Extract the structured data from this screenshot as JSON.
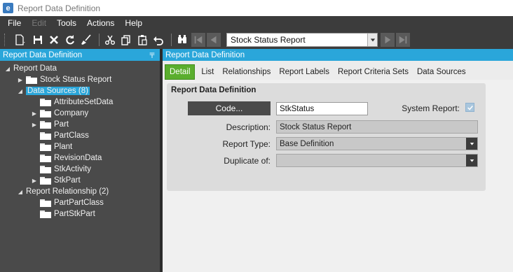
{
  "window": {
    "title": "Report Data Definition",
    "app_logo_letter": "e"
  },
  "menu": [
    "File",
    "Edit",
    "Tools",
    "Actions",
    "Help"
  ],
  "menu_disabled": [
    "Edit"
  ],
  "toolbar": {
    "icons": [
      "new-icon",
      "save-icon",
      "delete-icon",
      "refresh-icon",
      "clear-icon",
      "cut-icon",
      "copy-icon",
      "paste-icon",
      "undo-icon",
      "search-icon",
      "first-record-icon",
      "previous-record-icon",
      "next-record-icon",
      "last-record-icon"
    ],
    "record_selector": "Stock Status Report"
  },
  "left_panel": {
    "header": "Report Data Definition",
    "pin_glyph": "〒",
    "tree": [
      {
        "label": "Report Data",
        "expander": "◢",
        "level": 0,
        "folder": false
      },
      {
        "label": "Stock Status Report",
        "expander": "▶",
        "level": 1,
        "folder": true
      },
      {
        "label": "Data Sources (8)",
        "expander": "◢",
        "level": 1,
        "folder": false,
        "selected": true
      },
      {
        "label": "AttributeSetData",
        "expander": "",
        "level": 2,
        "folder": true
      },
      {
        "label": "Company",
        "expander": "▶",
        "level": 2,
        "folder": true
      },
      {
        "label": "Part",
        "expander": "▶",
        "level": 2,
        "folder": true
      },
      {
        "label": "PartClass",
        "expander": "",
        "level": 2,
        "folder": true
      },
      {
        "label": "Plant",
        "expander": "",
        "level": 2,
        "folder": true
      },
      {
        "label": "RevisionData",
        "expander": "",
        "level": 2,
        "folder": true
      },
      {
        "label": "StkActivity",
        "expander": "",
        "level": 2,
        "folder": true
      },
      {
        "label": "StkPart",
        "expander": "▶",
        "level": 2,
        "folder": true
      },
      {
        "label": "Report Relationship (2)",
        "expander": "◢",
        "level": 1,
        "folder": false
      },
      {
        "label": "PartPartClass",
        "expander": "",
        "level": 2,
        "folder": true
      },
      {
        "label": "PartStkPart",
        "expander": "",
        "level": 2,
        "folder": true
      }
    ]
  },
  "right_panel": {
    "header": "Report Data Definition",
    "tabs": [
      "Detail",
      "List",
      "Relationships",
      "Report Labels",
      "Report Criteria Sets",
      "Data Sources"
    ],
    "active_tab": "Detail",
    "group_title": "Report Data Definition",
    "code_button": "Code...",
    "code_value": "StkStatus",
    "system_report_label": "System Report:",
    "system_report_checked": true,
    "description_label": "Description:",
    "description_value": "Stock Status Report",
    "report_type_label": "Report Type:",
    "report_type_value": "Base Definition",
    "duplicate_of_label": "Duplicate of:",
    "duplicate_of_value": ""
  },
  "colors": {
    "accent": "#2aa6da",
    "active_tab": "#5aae2e",
    "dark": "#3c3c3c"
  }
}
